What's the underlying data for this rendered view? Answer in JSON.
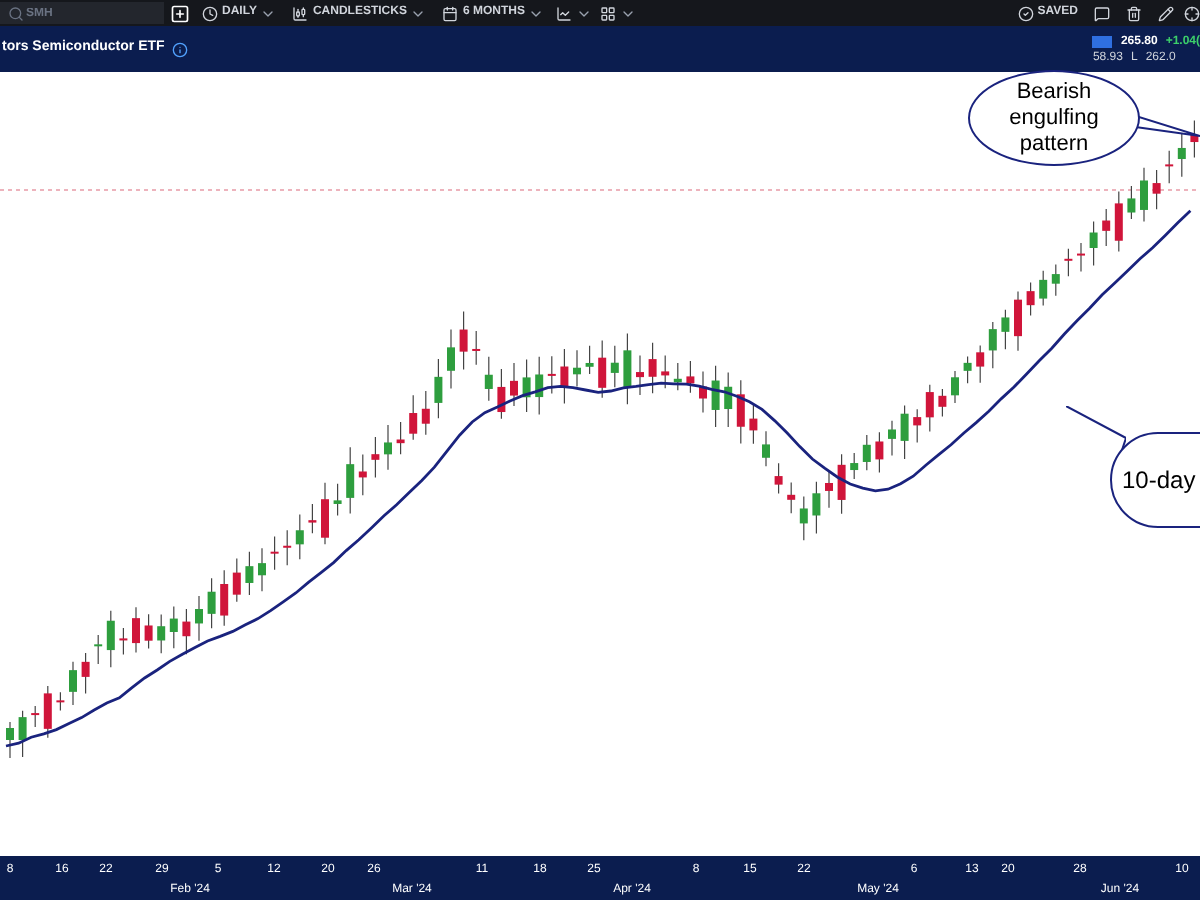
{
  "toolbar": {
    "search": {
      "placeholder": "SMH"
    },
    "interval": "DAILY",
    "chart_type": "CANDLESTICKS",
    "range": "6 MONTHS",
    "status": "SAVED"
  },
  "header": {
    "title": "tors Semiconductor ETF",
    "last_price": "265.80",
    "change": "+1.04(",
    "open": "58.93",
    "low_label": "L",
    "low": "262.0"
  },
  "callouts": [
    {
      "kind": "pattern",
      "text": "Bearish engulfing pattern"
    },
    {
      "kind": "average",
      "text": "10-day"
    }
  ],
  "x_axis": {
    "day_ticks": [
      "8",
      "16",
      "22",
      "29",
      "5",
      "12",
      "20",
      "26",
      "11",
      "18",
      "25",
      "8",
      "15",
      "22",
      "6",
      "13",
      "20",
      "28",
      "10"
    ],
    "month_ticks": [
      "Feb '24",
      "Mar '24",
      "Apr '24",
      "May '24",
      "Jun '24"
    ]
  }
}
